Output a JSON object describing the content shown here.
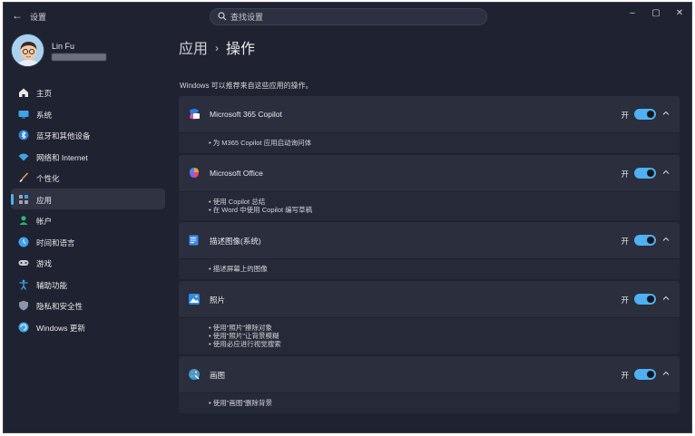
{
  "titlebar": {
    "back_icon": "back-arrow-icon",
    "title": "设置",
    "search_placeholder": "查找设置",
    "controls": [
      "minimize-icon",
      "maximize-icon",
      "close-icon"
    ]
  },
  "profile": {
    "name": "Lin Fu"
  },
  "sidebar": {
    "items": [
      {
        "label": "主页",
        "icon": "home-icon"
      },
      {
        "label": "系统",
        "icon": "system-icon"
      },
      {
        "label": "蓝牙和其他设备",
        "icon": "bluetooth-icon"
      },
      {
        "label": "网络和 Internet",
        "icon": "wifi-icon"
      },
      {
        "label": "个性化",
        "icon": "brush-icon"
      },
      {
        "label": "应用",
        "icon": "apps-icon",
        "active": true
      },
      {
        "label": "帐户",
        "icon": "account-icon"
      },
      {
        "label": "时间和语言",
        "icon": "time-language-icon"
      },
      {
        "label": "游戏",
        "icon": "gaming-icon"
      },
      {
        "label": "辅助功能",
        "icon": "accessibility-icon"
      },
      {
        "label": "隐私和安全性",
        "icon": "shield-icon"
      },
      {
        "label": "Windows 更新",
        "icon": "update-icon"
      }
    ]
  },
  "main": {
    "breadcrumb": {
      "parent": "应用",
      "separator": "›",
      "current": "操作"
    },
    "intro": "Windows 可以推荐来自这些应用的操作。",
    "toggle_on_label": "开",
    "cards": [
      {
        "title": "Microsoft 365 Copilot",
        "icon": "m365-copilot-icon",
        "on": true,
        "bullets": [
          "• 为 M365 Copilot 应用启动询问体"
        ]
      },
      {
        "title": "Microsoft Office",
        "icon": "office-icon",
        "on": true,
        "bullets": [
          "• 使用 Copilot 总结",
          "• 在 Word 中使用 Copilot 编写草稿"
        ]
      },
      {
        "title": "描述图像(系统)",
        "icon": "describe-image-icon",
        "on": true,
        "bullets": [
          "• 描述屏幕上的图像"
        ]
      },
      {
        "title": "照片",
        "icon": "photos-icon",
        "on": true,
        "bullets": [
          "• 使用\"照片\"擦除对象",
          "• 使用\"照片\"让背景模糊",
          "• 使用必应进行视觉搜索"
        ]
      },
      {
        "title": "画图",
        "icon": "paint-icon",
        "on": true,
        "bullets": [
          "• 使用\"画图\"删除背景"
        ]
      }
    ]
  },
  "colors": {
    "accent": "#4fb0f2",
    "window_bg": "#1f2230",
    "card_bg": "#2a2e3d"
  }
}
